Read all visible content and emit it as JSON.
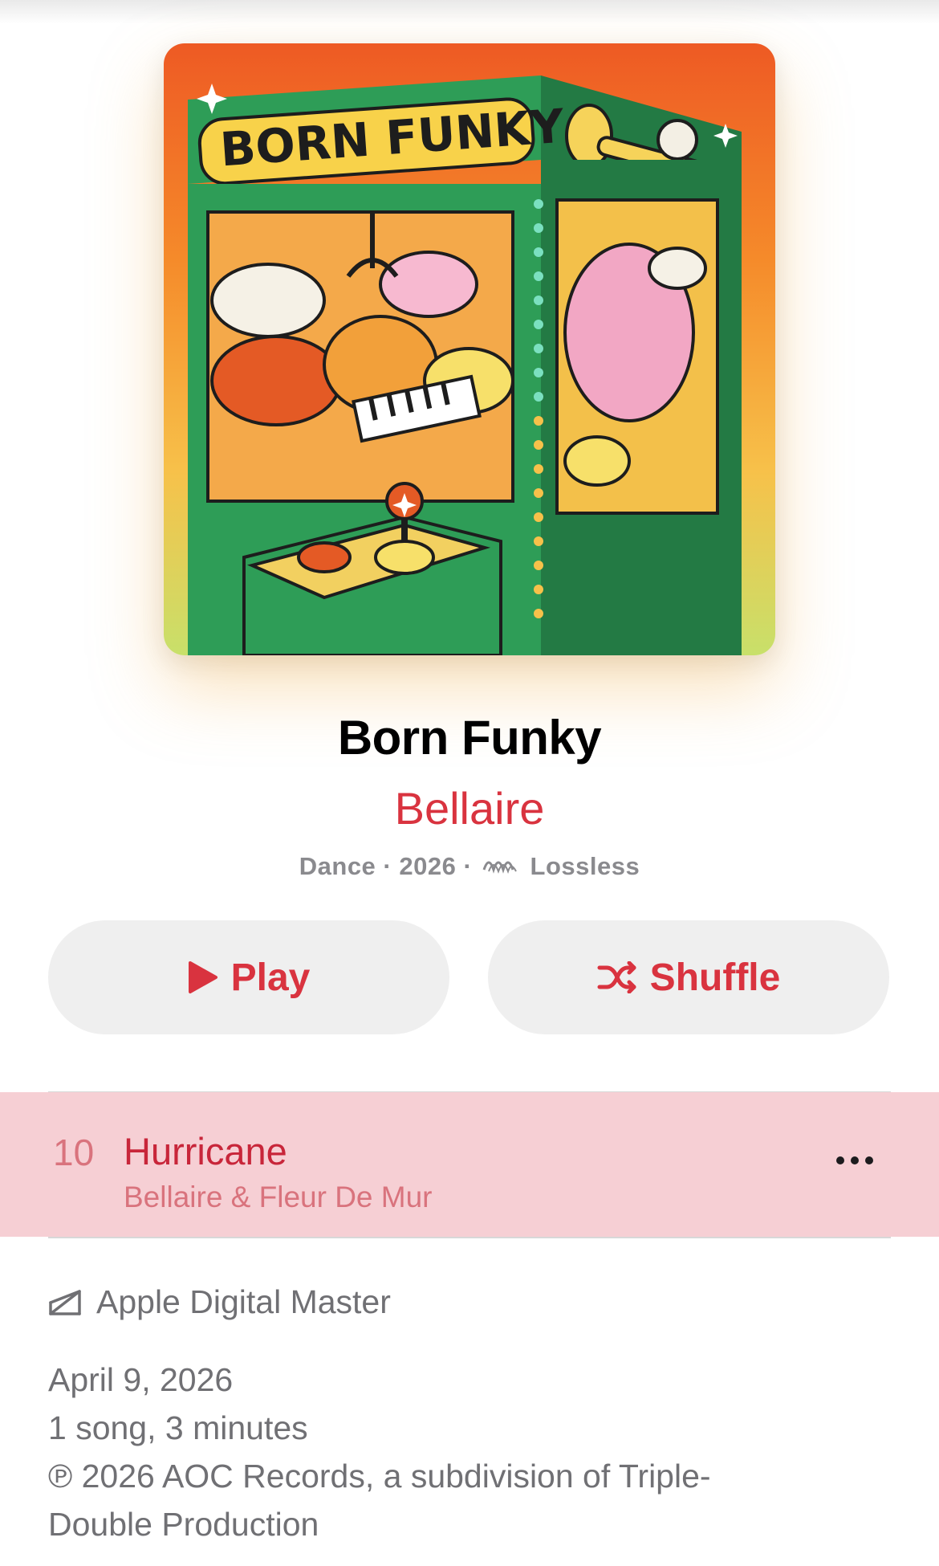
{
  "album": {
    "title": "Born Funky",
    "artist": "Bellaire",
    "artwork_text": "BORN FUNKY",
    "meta": {
      "genre": "Dance",
      "separator": "·",
      "year": "2026",
      "quality": "Lossless",
      "quality_icon": "lossless-waveform-icon"
    }
  },
  "actions": {
    "play_label": "Play",
    "play_icon": "play-icon",
    "shuffle_label": "Shuffle",
    "shuffle_icon": "shuffle-icon"
  },
  "tracks": [
    {
      "number": "10",
      "title": "Hurricane",
      "artists": "Bellaire & Fleur De Mur",
      "more_icon": "ellipsis-icon"
    }
  ],
  "footer": {
    "mastering_label": "Apple Digital Master",
    "mastering_icon": "apple-digital-master-icon",
    "release_date": "April 9, 2026",
    "summary": "1 song, 3 minutes",
    "copyright_line1": "℗ 2026 AOC Records, a subdivision of Triple-",
    "copyright_line2": "Double Production"
  },
  "colors": {
    "accent": "#d9333f",
    "secondary_text": "#8a8a8e",
    "button_background": "#efefef",
    "highlight_row": "#f6cfd4"
  }
}
